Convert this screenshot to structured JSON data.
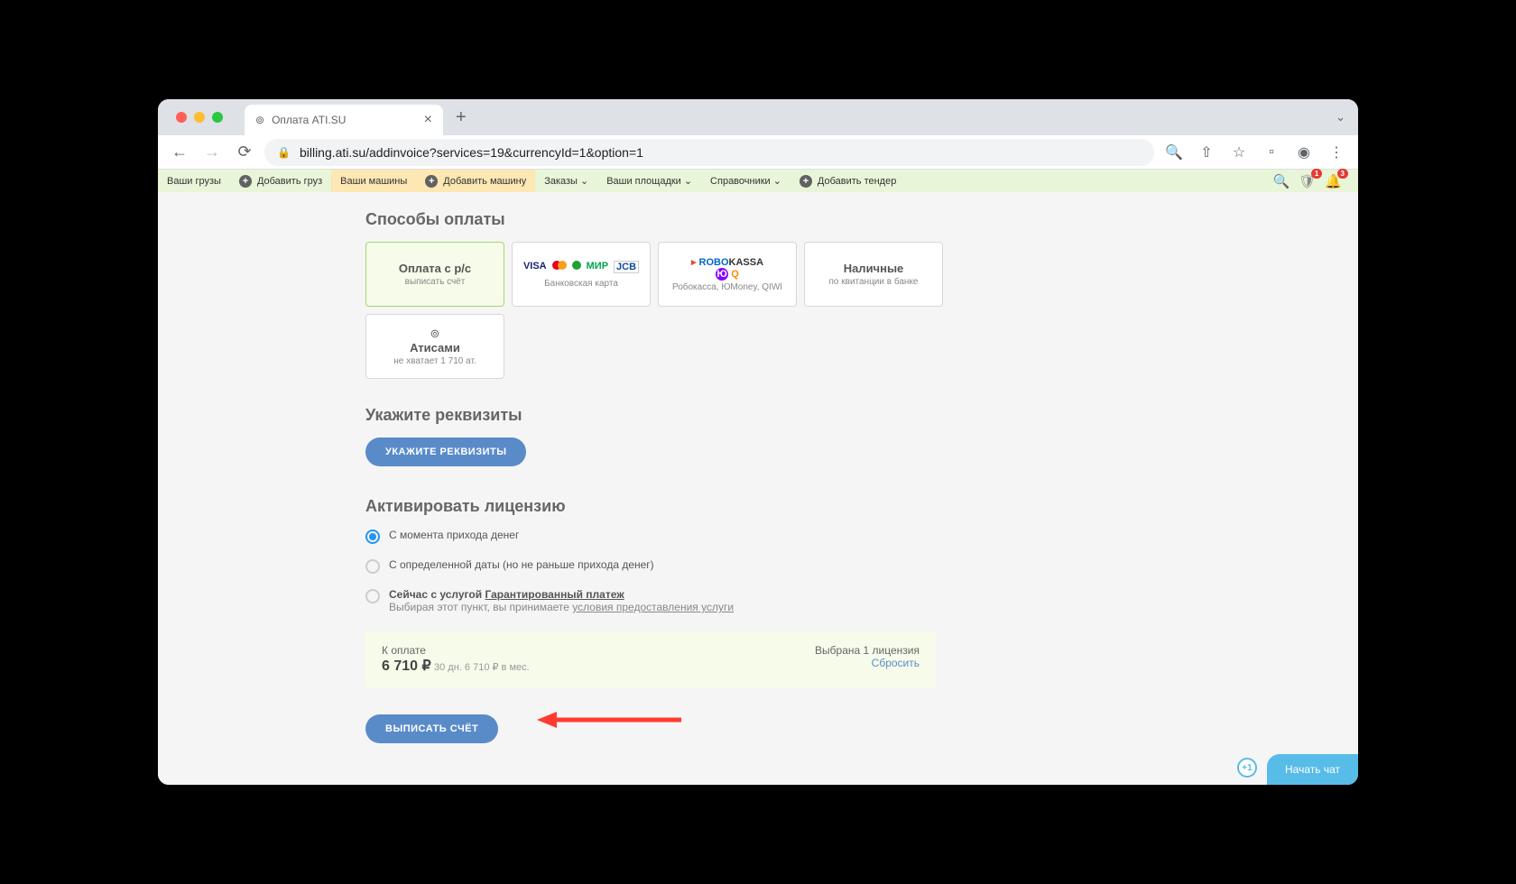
{
  "browser": {
    "tab_title": "Оплата ATI.SU",
    "url": "billing.ati.su/addinvoice?services=19&currencyId=1&option=1"
  },
  "nav": {
    "cargo": "Ваши грузы",
    "add_cargo": "Добавить груз",
    "trucks": "Ваши машины",
    "add_truck": "Добавить машину",
    "orders": "Заказы",
    "platforms": "Ваши площадки",
    "refs": "Справочники",
    "add_tender": "Добавить тендер",
    "badge1": "1",
    "badge2": "3"
  },
  "sections": {
    "payment_methods": "Способы оплаты",
    "requisites": "Укажите реквизиты",
    "activate": "Активировать лицензию"
  },
  "cards": {
    "bank": {
      "title": "Оплата с р/с",
      "sub": "выписать счёт"
    },
    "card": {
      "sub": "Банковская карта"
    },
    "robo": {
      "title": "ROBOKASSA",
      "sub": "Робокасса, ЮMoney, QIWI"
    },
    "cash": {
      "title": "Наличные",
      "sub": "по квитанции в банке"
    },
    "atis": {
      "title": "Атисами",
      "sub": "не хватает 1 710 ат."
    }
  },
  "buttons": {
    "requisites": "УКАЖИТЕ РЕКВИЗИТЫ",
    "invoice": "ВЫПИСАТЬ СЧЁТ"
  },
  "radios": {
    "r1": "С момента прихода денег",
    "r2": "С определенной даты (но не раньше прихода денег)",
    "r3a": "Сейчас с услугой ",
    "r3b": "Гарантированный платеж",
    "r3c": "Выбирая этот пункт, вы принимаете ",
    "r3d": "условия предоставления услуги"
  },
  "summary": {
    "label": "К оплате",
    "amount": "6 710 ₽",
    "detail": "30 дн.  6 710 ₽ в мес.",
    "licenses": "Выбрана 1 лицензия",
    "reset": "Сбросить"
  },
  "chat": {
    "label": "Начать чат",
    "count": "+1"
  }
}
